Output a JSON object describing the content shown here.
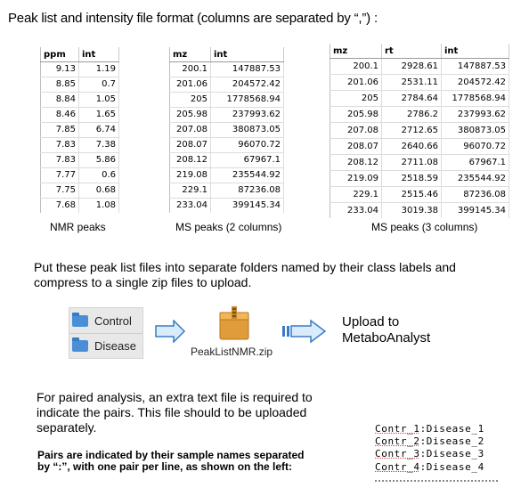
{
  "title": "Peak list and intensity file format (columns are separated by “,”) :",
  "nmr_table": {
    "headers": [
      "ppm",
      "int"
    ],
    "rows": [
      [
        "9.13",
        "1.19"
      ],
      [
        "8.85",
        "0.7"
      ],
      [
        "8.84",
        "1.05"
      ],
      [
        "8.46",
        "1.65"
      ],
      [
        "7.85",
        "6.74"
      ],
      [
        "7.83",
        "7.38"
      ],
      [
        "7.83",
        "5.86"
      ],
      [
        "7.77",
        "0.6"
      ],
      [
        "7.75",
        "0.68"
      ],
      [
        "7.68",
        "1.08"
      ]
    ],
    "caption": "NMR peaks"
  },
  "ms2_table": {
    "headers": [
      "mz",
      "int"
    ],
    "rows": [
      [
        "200.1",
        "147887.53"
      ],
      [
        "201.06",
        "204572.42"
      ],
      [
        "205",
        "1778568.94"
      ],
      [
        "205.98",
        "237993.62"
      ],
      [
        "207.08",
        "380873.05"
      ],
      [
        "208.07",
        "96070.72"
      ],
      [
        "208.12",
        "67967.1"
      ],
      [
        "219.08",
        "235544.92"
      ],
      [
        "229.1",
        "87236.08"
      ],
      [
        "233.04",
        "399145.34"
      ]
    ],
    "caption": "MS peaks (2 columns)"
  },
  "ms3_table": {
    "headers": [
      "mz",
      "rt",
      "int"
    ],
    "rows": [
      [
        "200.1",
        "2928.61",
        "147887.53"
      ],
      [
        "201.06",
        "2531.11",
        "204572.42"
      ],
      [
        "205",
        "2784.64",
        "1778568.94"
      ],
      [
        "205.98",
        "2786.2",
        "237993.62"
      ],
      [
        "207.08",
        "2712.65",
        "380873.05"
      ],
      [
        "208.07",
        "2640.66",
        "96070.72"
      ],
      [
        "208.12",
        "2711.08",
        "67967.1"
      ],
      [
        "219.09",
        "2518.59",
        "235544.92"
      ],
      [
        "229.1",
        "2515.46",
        "87236.08"
      ],
      [
        "233.04",
        "3019.38",
        "399145.34"
      ]
    ],
    "caption": "MS peaks (3 columns)"
  },
  "instruction": {
    "line1": "Put these peak list files into separate folders named by their class labels and",
    "line2": "compress to a single zip files to upload."
  },
  "folders": [
    {
      "label": "Control",
      "icon": "folder-icon"
    },
    {
      "label": "Disease",
      "icon": "folder-icon"
    }
  ],
  "zip": {
    "label": "PeakListNMR.zip",
    "icon": "zip-archive-icon"
  },
  "upload": {
    "line1": "Upload to",
    "line2": "MetaboAnalyst"
  },
  "paired": {
    "line1": "For paired analysis, an extra text file is required to",
    "line2": "indicate the pairs. This file should to be uploaded",
    "line3": "separately."
  },
  "note": {
    "line1": "Pairs are indicated by their sample names separated",
    "line2": "by “:”, with one pair per line, as shown on the left:"
  },
  "pairs": [
    {
      "a": "Contr_1",
      "b": ":Disease_1"
    },
    {
      "a": "Contr_2",
      "b": ":Disease_2"
    },
    {
      "a": "Contr_3",
      "b": ":Disease_3"
    },
    {
      "a": "Contr_4",
      "b": ":Disease_4"
    }
  ],
  "colors": {
    "arrow_fill": "#d8ecfb",
    "arrow_stroke": "#3a7bc4",
    "folder": "#4a8fd6",
    "zip": "#e09c3a"
  }
}
